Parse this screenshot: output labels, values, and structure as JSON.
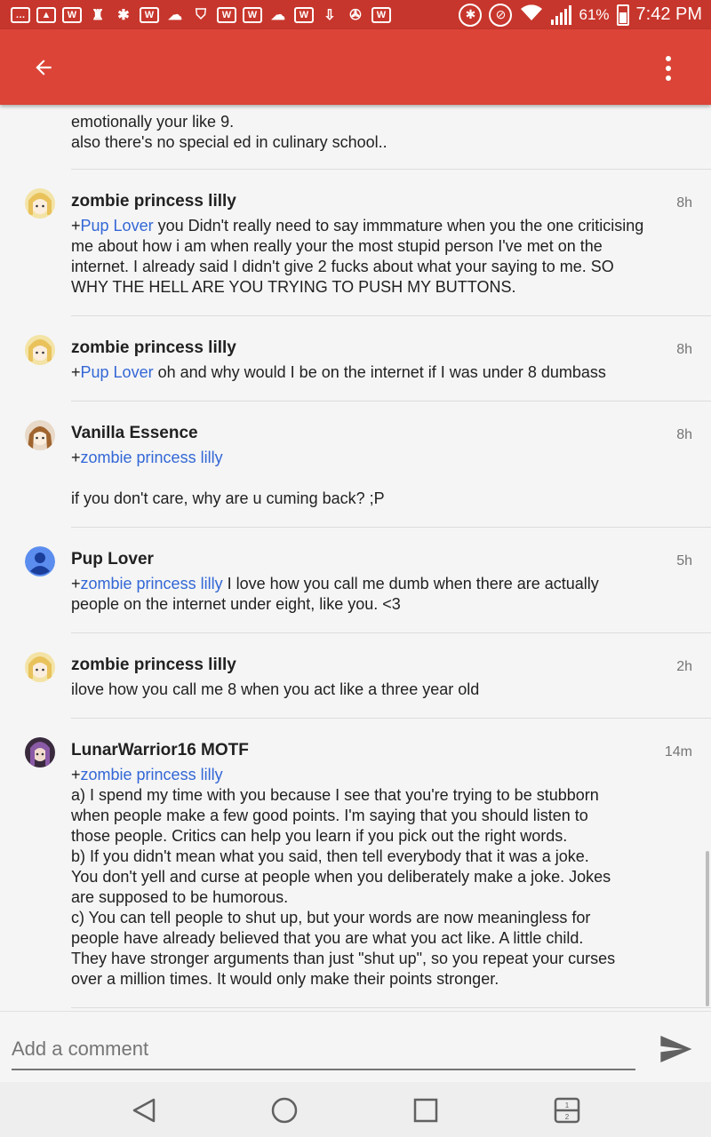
{
  "status_bar": {
    "battery": "61%",
    "time": "7:42 PM"
  },
  "prev_comment": {
    "lines": [
      "emotionally your like 9.",
      "also there's no special ed in culinary school.."
    ]
  },
  "comments": [
    {
      "author": "zombie princess lilly",
      "time": "8h",
      "avatar": "anime-blonde-avatar",
      "mention": "Pup Lover",
      "text": " you Didn't really need to say immmature when you the one criticising me about how i am when really your the most stupid person I've met on the internet. I already said I didn't give 2 fucks about what your saying to me. SO WHY THE HELL ARE YOU TRYING TO PUSH MY BUTTONS."
    },
    {
      "author": "zombie princess lilly",
      "time": "8h",
      "avatar": "anime-blonde-avatar",
      "mention": "Pup Lover",
      "text": " oh and why would I be on the internet if I was under 8 dumbass"
    },
    {
      "author": "Vanilla Essence",
      "time": "8h",
      "avatar": "anime-brown-avatar",
      "mention": "zombie princess lilly",
      "text": "if you don't care, why are u cuming back? ;P"
    },
    {
      "author": "Pup Lover",
      "time": "5h",
      "avatar": "default-user-avatar",
      "mention": "zombie princess lilly",
      "text": " I love how you call me dumb when there are actually people on the internet under eight, like you. <3"
    },
    {
      "author": "zombie princess lilly",
      "time": "2h",
      "avatar": "anime-blonde-avatar",
      "text": "ilove how you call me 8 when you act like a three year old"
    },
    {
      "author": "LunarWarrior16 MOTF",
      "time": "14m",
      "avatar": "anime-purple-avatar",
      "mention": "zombie princess lilly",
      "lines": [
        "a) I spend my time with you because I see that you're trying to be stubborn",
        "when people make a few good points. I'm saying that you should listen to",
        "those people. Critics can help you learn if you pick out the right words.",
        "b) If you didn't mean what you said, then tell everybody that it was a joke.",
        "You don't yell and curse at people when you deliberately make a joke. Jokes",
        "are supposed to be humorous.",
        "c) You can tell people to shut up, but your words are now meaningless for",
        "people have already believed that you are what you act like. A little child.",
        "They have stronger arguments than just \"shut up\", so you repeat your curses",
        "over a million times. It would only make their points stronger."
      ]
    }
  ],
  "input": {
    "placeholder": "Add a comment"
  },
  "colors": {
    "app_bar": "#db4437",
    "status_bar": "#c7362c",
    "mention": "#3367d6"
  },
  "icons": {
    "back": "arrow-left-icon",
    "menu": "overflow-menu-icon",
    "send": "send-icon",
    "nav_back": "triangle-back-icon",
    "nav_home": "circle-home-icon",
    "nav_recent": "square-recent-icon",
    "nav_dual": "dual-window-icon"
  }
}
